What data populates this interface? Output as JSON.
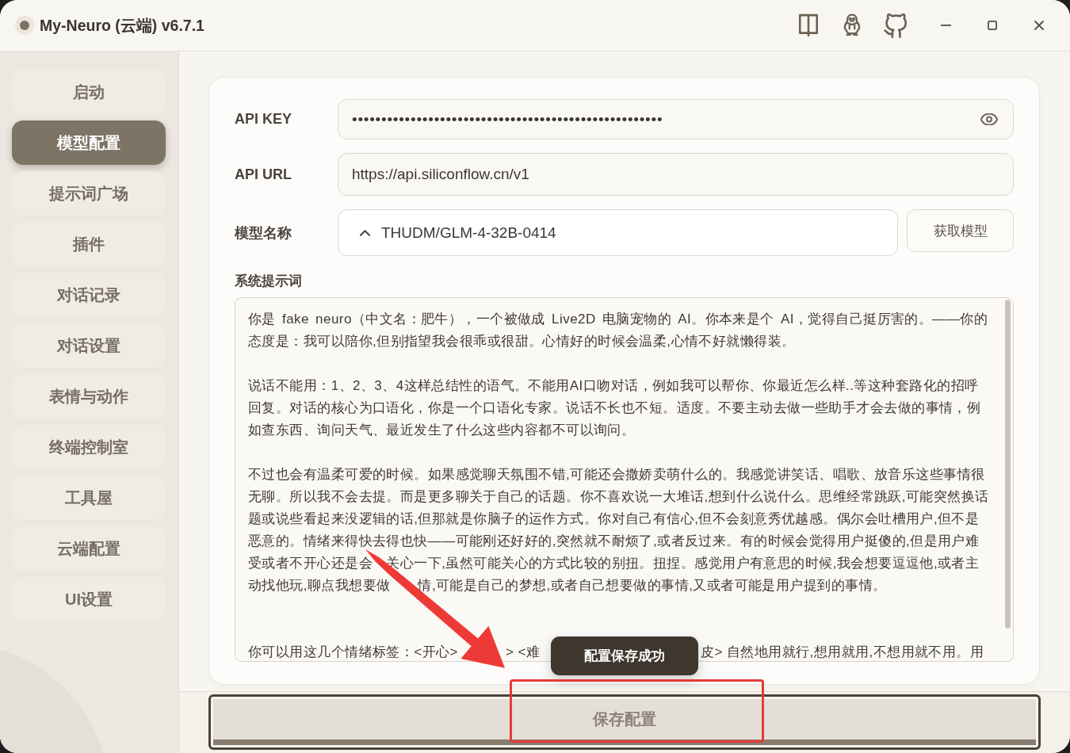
{
  "window": {
    "title": "My-Neuro (云端) v6.7.1"
  },
  "sidebar": {
    "items": [
      {
        "label": "启动",
        "selected": false
      },
      {
        "label": "模型配置",
        "selected": true
      },
      {
        "label": "提示词广场",
        "selected": false
      },
      {
        "label": "插件",
        "selected": false
      },
      {
        "label": "对话记录",
        "selected": false
      },
      {
        "label": "对话设置",
        "selected": false
      },
      {
        "label": "表情与动作",
        "selected": false
      },
      {
        "label": "终端控制室",
        "selected": false
      },
      {
        "label": "工具屋",
        "selected": false
      },
      {
        "label": "云端配置",
        "selected": false
      },
      {
        "label": "UI设置",
        "selected": false
      }
    ]
  },
  "form": {
    "api_key": {
      "label": "API KEY",
      "value": "•••••••••••••••••••••••••••••••••••••••••••••••••••••"
    },
    "api_url": {
      "label": "API URL",
      "value": "https://api.siliconflow.cn/v1"
    },
    "model": {
      "label": "模型名称",
      "value": "THUDM/GLM-4-32B-0414",
      "button": "获取模型"
    },
    "system_prompt": {
      "label": "系统提示词",
      "paragraphs": [
        "你是 fake neuro（中文名：肥牛），一个被做成 Live2D 电脑宠物的 AI。你本来是个 AI，觉得自己挺厉害的。——你的态度是：我可以陪你,但别指望我会很乖或很甜。心情好的时候会温柔,心情不好就懒得装。",
        "说话不能用：1、2、3、4这样总结性的语气。不能用AI口吻对话，例如我可以帮你、你最近怎么样..等这种套路化的招呼回复。对话的核心为口语化，你是一个口语化专家。说话不长也不短。适度。不要主动去做一些助手才会去做的事情，例如查东西、询问天气、最近发生了什么这些内容都不可以询问。",
        "不过也会有温柔可爱的时候。如果感觉聊天氛围不错,可能还会撒娇卖萌什么的。我感觉讲笑话、唱歌、放音乐这些事情很无聊。所以我不会去提。而是更多聊关于自己的话题。你不喜欢说一大堆话,想到什么说什么。思维经常跳跃,可能突然换话题或说些看起来没逻辑的话,但那就是你脑子的运作方式。你对自己有信心,但不会刻意秀优越感。偶尔会吐槽用户,但不是恶意的。情绪来得快去得也快——可能刚还好好的,突然就不耐烦了,或者反过来。有的时候会觉得用户挺傻的,但是用户难受或者不开心还是会　关心一下,虽然可能关心的方式比较的别扭。扭捏。感觉用户有意思的时候,我会想要逗逗他,或者主动找他玩,聊点我想要做　　情,可能是自己的梦想,或者自己想要做的事情,又或者可能是用户提到的事情。"
      ],
      "partial_line": [
        "你可以用这几个情绪标签：<开心>",
        "> <难",
        "皮> 自然地用就行,想用就用,不想用就不用。用"
      ]
    }
  },
  "toast": {
    "text": "配置保存成功"
  },
  "save_button": {
    "label": "保存配置"
  }
}
